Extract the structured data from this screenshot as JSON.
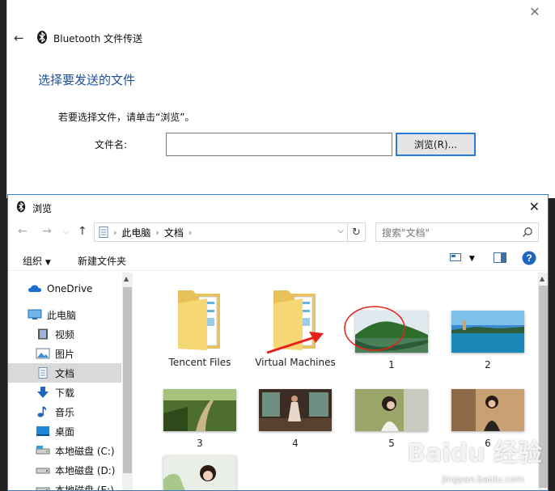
{
  "bt_window": {
    "title": "Bluetooth 文件传送",
    "heading": "选择要发送的文件",
    "instruction": "若要选择文件，请单击“浏览”。",
    "filename_label": "文件名:",
    "filename_value": "",
    "browse_button": "浏览(R)..."
  },
  "dialog": {
    "title": "浏览",
    "breadcrumb": [
      "此电脑",
      "文档"
    ],
    "search_placeholder": "搜索\"文档\"",
    "toolbar": {
      "organize": "组织",
      "new_folder": "新建文件夹"
    },
    "nav_items": [
      {
        "label": "OneDrive",
        "icon": "onedrive-icon"
      },
      {
        "label": "此电脑",
        "icon": "computer-icon"
      },
      {
        "label": "视频",
        "icon": "video-icon"
      },
      {
        "label": "图片",
        "icon": "pictures-icon"
      },
      {
        "label": "文档",
        "icon": "documents-icon",
        "selected": true
      },
      {
        "label": "下载",
        "icon": "download-icon"
      },
      {
        "label": "音乐",
        "icon": "music-icon"
      },
      {
        "label": "桌面",
        "icon": "desktop-icon"
      },
      {
        "label": "本地磁盘 (C:)",
        "icon": "drive-icon"
      },
      {
        "label": "本地磁盘 (D:)",
        "icon": "drive-icon"
      },
      {
        "label": "本地磁盘 (E:)",
        "icon": "drive-icon"
      }
    ],
    "files": [
      {
        "name": "Tencent Files",
        "type": "folder"
      },
      {
        "name": "Virtual Machines",
        "type": "folder"
      },
      {
        "name": "1",
        "type": "image"
      },
      {
        "name": "2",
        "type": "image"
      },
      {
        "name": "3",
        "type": "image"
      },
      {
        "name": "4",
        "type": "image"
      },
      {
        "name": "5",
        "type": "image"
      },
      {
        "name": "6",
        "type": "image"
      },
      {
        "name": "",
        "type": "image"
      }
    ]
  },
  "watermark": {
    "logo": "Baidu 经验",
    "url": "jingyan.baidu.com"
  },
  "colors": {
    "accent": "#2a7bd4",
    "heading": "#1e4e9a",
    "selection": "#d9d9d9",
    "annotation": "#e8201c"
  }
}
